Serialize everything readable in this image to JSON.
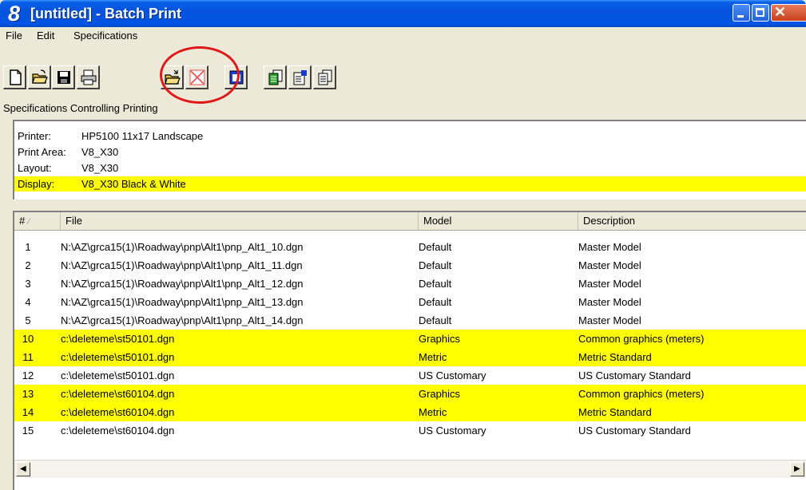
{
  "window": {
    "icon_glyph": "8",
    "title": "[untitled] - Batch Print"
  },
  "menu": [
    "File",
    "Edit",
    "Specifications"
  ],
  "toolbar": {
    "buttons": [
      "new-document-icon",
      "open-folder-icon",
      "save-disk-icon",
      "print-icon",
      "open-spec-icon",
      "delete-spec-icon",
      "window-icon",
      "print-specs-icon",
      "properties-icon",
      "page-setup-icon"
    ],
    "highlight_color": "#e01818"
  },
  "specs": {
    "caption": "Specifications Controlling Printing",
    "rows": [
      {
        "label": "Printer:",
        "value": "HP5100 11x17 Landscape",
        "highlighted": false
      },
      {
        "label": "Print Area:",
        "value": "V8_X30",
        "highlighted": false
      },
      {
        "label": "Layout:",
        "value": "V8_X30",
        "highlighted": false
      },
      {
        "label": "Display:",
        "value": "V8_X30 Black & White",
        "highlighted": true
      }
    ]
  },
  "file_list": {
    "columns": {
      "num": "#",
      "file": "File",
      "model": "Model",
      "description": "Description"
    },
    "rows": [
      {
        "num": "1",
        "file": "N:\\AZ\\grca15(1)\\Roadway\\pnp\\Alt1\\pnp_Alt1_10.dgn",
        "model": "Default",
        "description": "Master Model",
        "highlighted": false
      },
      {
        "num": "2",
        "file": "N:\\AZ\\grca15(1)\\Roadway\\pnp\\Alt1\\pnp_Alt1_11.dgn",
        "model": "Default",
        "description": "Master Model",
        "highlighted": false
      },
      {
        "num": "3",
        "file": "N:\\AZ\\grca15(1)\\Roadway\\pnp\\Alt1\\pnp_Alt1_12.dgn",
        "model": "Default",
        "description": "Master Model",
        "highlighted": false
      },
      {
        "num": "4",
        "file": "N:\\AZ\\grca15(1)\\Roadway\\pnp\\Alt1\\pnp_Alt1_13.dgn",
        "model": "Default",
        "description": "Master Model",
        "highlighted": false
      },
      {
        "num": "5",
        "file": "N:\\AZ\\grca15(1)\\Roadway\\pnp\\Alt1\\pnp_Alt1_14.dgn",
        "model": "Default",
        "description": "Master Model",
        "highlighted": false
      },
      {
        "num": "10",
        "file": "c:\\deleteme\\st50101.dgn",
        "model": "Graphics",
        "description": "Common graphics (meters)",
        "highlighted": true
      },
      {
        "num": "11",
        "file": "c:\\deleteme\\st50101.dgn",
        "model": "Metric",
        "description": "Metric Standard",
        "highlighted": true
      },
      {
        "num": "12",
        "file": "c:\\deleteme\\st50101.dgn",
        "model": "US Customary",
        "description": "US Customary Standard",
        "highlighted": false
      },
      {
        "num": "13",
        "file": "c:\\deleteme\\st60104.dgn",
        "model": "Graphics",
        "description": "Common graphics (meters)",
        "highlighted": true
      },
      {
        "num": "14",
        "file": "c:\\deleteme\\st60104.dgn",
        "model": "Metric",
        "description": "Metric Standard",
        "highlighted": true
      },
      {
        "num": "15",
        "file": "c:\\deleteme\\st60104.dgn",
        "model": "US Customary",
        "description": "US Customary Standard",
        "highlighted": false
      }
    ]
  },
  "colors": {
    "highlight": "#ffff00",
    "title_bar": "#0553dd"
  }
}
